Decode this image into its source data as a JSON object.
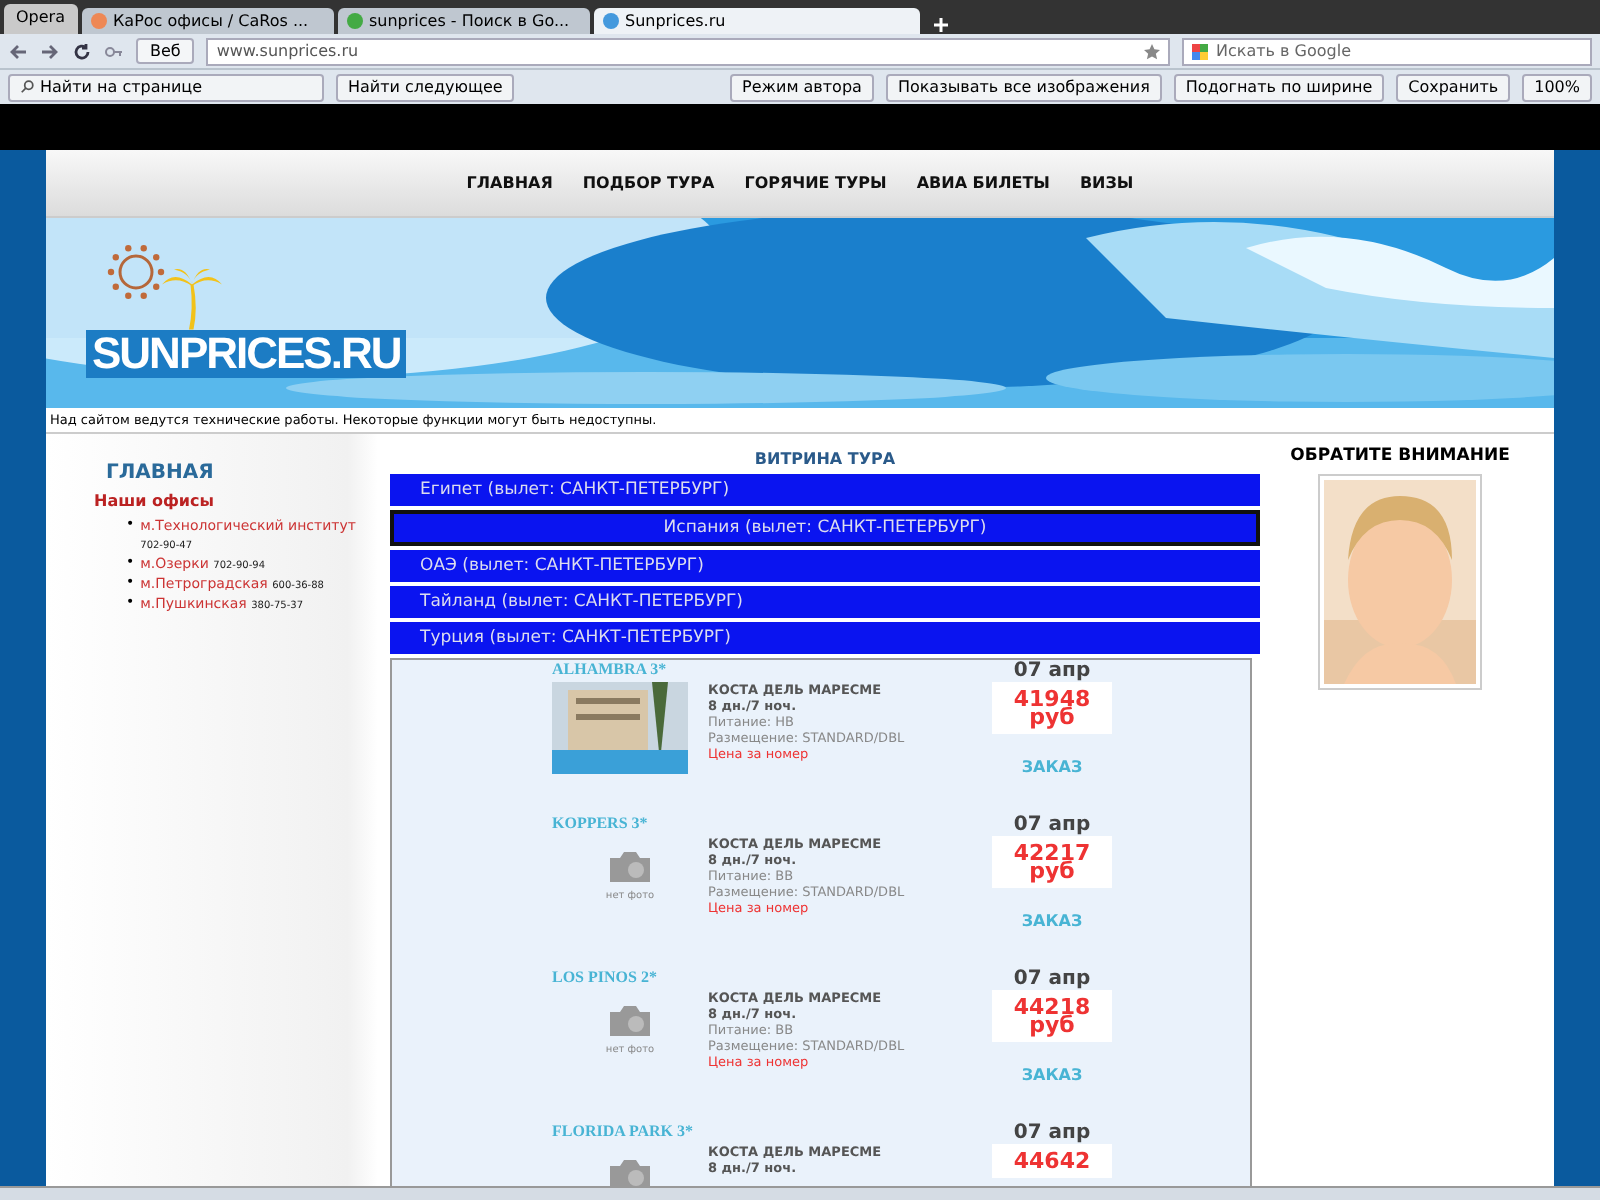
{
  "browser": {
    "menu_button": "Opera",
    "tabs": [
      {
        "label": "КаРос офисы / CaRos ...",
        "selected": false
      },
      {
        "label": "sunprices - Поиск в Go...",
        "selected": false
      },
      {
        "label": "Sunprices.ru",
        "selected": true
      }
    ],
    "address_badge": "Веб",
    "address": "www.sunprices.ru",
    "search_placeholder": "Искать в Google",
    "find_placeholder": "Найти на странице",
    "find_next": "Найти следующее",
    "toolbar_buttons": [
      "Режим автора",
      "Показывать все изображения",
      "Подогнать по ширине",
      "Сохранить"
    ],
    "zoom": "100%"
  },
  "nav": [
    "ГЛАВНАЯ",
    "ПОДБОР ТУРА",
    "ГОРЯЧИЕ ТУРЫ",
    "АВИА БИЛЕТЫ",
    "ВИЗЫ"
  ],
  "logo": "SUNPRICES.RU",
  "notice": "Над сайтом ведутся технические работы. Некоторые функции могут быть недоступны.",
  "sidebar": {
    "title": "ГЛАВНАЯ",
    "heading": "Наши офисы",
    "offices": [
      {
        "marker": "•",
        "name": "м.Технологический институт",
        "phone": "702-90-47"
      },
      {
        "marker": "•",
        "name": "м.Озерки",
        "phone": "702-90-94"
      },
      {
        "marker": "•",
        "name": "м.Петроградская",
        "phone": "600-36-88"
      },
      {
        "marker": "•",
        "name": "м.Пушкинская",
        "phone": "380-75-37"
      }
    ]
  },
  "showcase": {
    "title": "ВИТРИНА ТУРА",
    "destinations": [
      {
        "label": "Египет (вылет: САНКТ-ПЕТЕРБУРГ)",
        "selected": false
      },
      {
        "label": "Испания (вылет: САНКТ-ПЕТЕРБУРГ)",
        "selected": true
      },
      {
        "label": "ОАЭ (вылет: САНКТ-ПЕТЕРБУРГ)",
        "selected": false
      },
      {
        "label": "Тайланд (вылет: САНКТ-ПЕТЕРБУРГ)",
        "selected": false
      },
      {
        "label": "Турция (вылет: САНКТ-ПЕТЕРБУРГ)",
        "selected": false
      }
    ],
    "tours": [
      {
        "name": "ALHAMBRA 3*",
        "kind": "picture",
        "resort": "КОСТА ДЕЛЬ МАРЕСМЕ",
        "duration": "8 дн./7 ноч.",
        "details": [
          "Питание: HB",
          "Размещение: STANDARD/DBL"
        ],
        "price_note": "Цена за номер",
        "date": "07 апр",
        "price": "41948",
        "currency": "руб",
        "order": "ЗАКАЗ"
      },
      {
        "name": "KOPPERS 3*",
        "kind": "no-photo",
        "photo_label": "нет фото",
        "resort": "КОСТА ДЕЛЬ МАРЕСМЕ",
        "duration": "8 дн./7 ноч.",
        "details": [
          "Питание: BB",
          "Размещение: STANDARD/DBL"
        ],
        "price_note": "Цена за номер",
        "date": "07 апр",
        "price": "42217",
        "currency": "руб",
        "order": "ЗАКАЗ"
      },
      {
        "name": "LOS PINOS 2*",
        "kind": "no-photo",
        "photo_label": "нет фото",
        "resort": "КОСТА ДЕЛЬ МАРЕСМЕ",
        "duration": "8 дн./7 ноч.",
        "details": [
          "Питание: BB",
          "Размещение: STANDARD/DBL"
        ],
        "price_note": "Цена за номер",
        "date": "07 апр",
        "price": "44218",
        "currency": "руб",
        "order": "ЗАКАЗ"
      },
      {
        "name": "FLORIDA PARK 3*",
        "kind": "no-photo",
        "resort": "КОСТА ДЕЛЬ МАРЕСМЕ",
        "duration": "8 дн./7 ноч.",
        "date": "07 апр",
        "price": "44642"
      }
    ]
  },
  "attention": {
    "title": "ОБРАТИТЕ ВНИМАНИЕ"
  }
}
